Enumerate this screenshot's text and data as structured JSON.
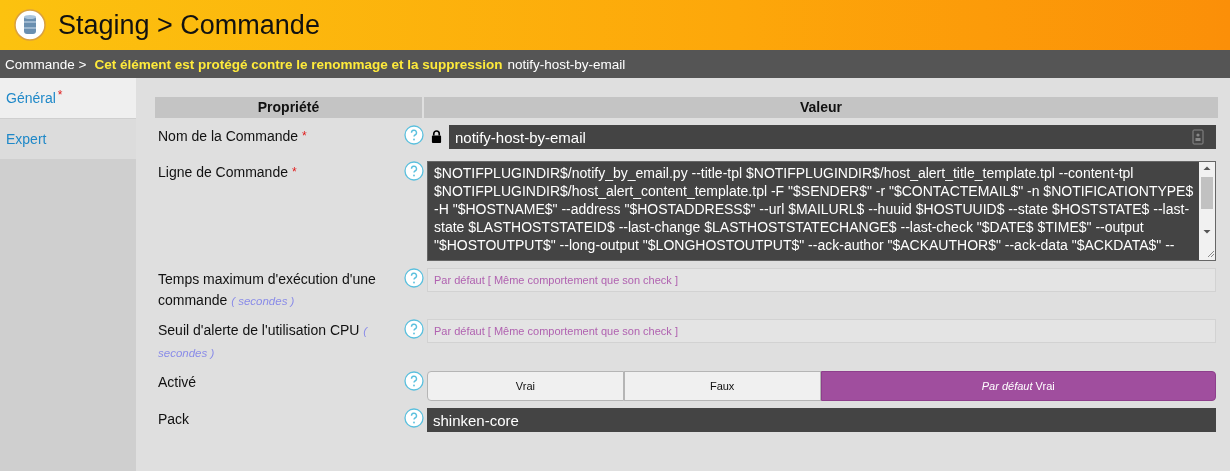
{
  "header": {
    "title": "Staging > Commande"
  },
  "breadcrumb": {
    "parent": "Commande >",
    "warning": "Cet élément est protégé contre le renommage et la suppression",
    "item": "notify-host-by-email"
  },
  "tabs": [
    {
      "label": "Général",
      "required_mark": "*",
      "selected": true
    },
    {
      "label": "Expert",
      "selected": false
    }
  ],
  "table": {
    "columns": [
      "Propriété",
      "Valeur"
    ],
    "rows": [
      {
        "kind": "text",
        "label": "Nom de la Commande",
        "required_mark": "*",
        "locked": true,
        "value": "notify-host-by-email"
      },
      {
        "kind": "textarea",
        "label": "Ligne de Commande",
        "required_mark": "*",
        "value": "$NOTIFPLUGINDIR$/notify_by_email.py --title-tpl $NOTIFPLUGINDIR$/host_alert_title_template.tpl --content-tpl $NOTIFPLUGINDIR$/host_alert_content_template.tpl -F \"$SENDER$\" -r \"$CONTACTEMAIL$\" -n $NOTIFICATIONTYPE$ -H \"$HOSTNAME$\" --address \"$HOSTADDRESS$\" --url $MAILURL$ --huuid $HOSTUUID$ --state $HOSTSTATE$ --last-state $LASTHOSTSTATEID$ --last-change $LASTHOSTSTATECHANGE$  --last-check \"$DATE$ $TIME$\" --output \"$HOSTOUTPUT$\" --long-output \"$LONGHOSTOUTPUT$\" --ack-author \"$ACKAUTHOR$\" --ack-data \"$ACKDATA$\" --"
      },
      {
        "kind": "text",
        "label": "Temps maximum d'exécution d'une commande",
        "unit": "( secondes )",
        "locked": false,
        "placeholder": "Par défaut [ Même comportement que son check ]"
      },
      {
        "kind": "text",
        "label": "Seuil d'alerte de l'utilisation CPU",
        "unit": "( secondes )",
        "locked": false,
        "placeholder": "Par défaut [ Même comportement que son check ]"
      },
      {
        "kind": "choice",
        "label": "Activé",
        "options": [
          {
            "label": "Vrai",
            "selected": false
          },
          {
            "label": "Faux",
            "selected": false
          },
          {
            "label": "*Par défaut* Vrai",
            "selected": true
          }
        ]
      },
      {
        "kind": "text",
        "label": "Pack",
        "locked": false,
        "value": "shinken-core"
      }
    ]
  }
}
